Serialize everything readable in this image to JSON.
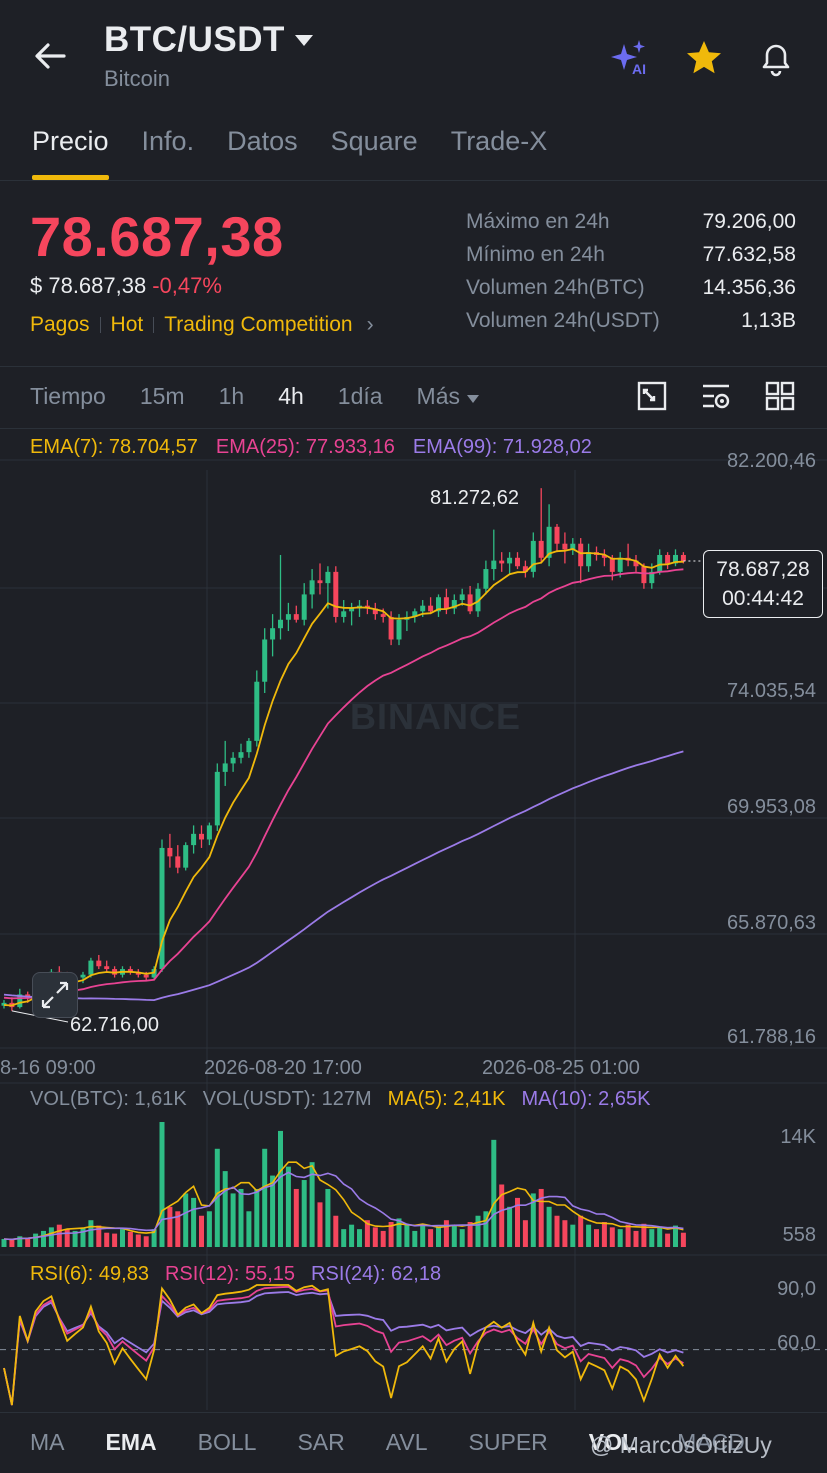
{
  "header": {
    "pair": "BTC/USDT",
    "name": "Bitcoin"
  },
  "tabs": [
    "Precio",
    "Info.",
    "Datos",
    "Square",
    "Trade-X"
  ],
  "price": {
    "last": "78.687,38",
    "usd": "$ 78.687,38",
    "change": "-0,47%"
  },
  "links": [
    "Pagos",
    "Hot",
    "Trading Competition"
  ],
  "stats": [
    {
      "label": "Máximo en 24h",
      "value": "79.206,00"
    },
    {
      "label": "Mínimo en 24h",
      "value": "77.632,58"
    },
    {
      "label": "Volumen 24h(BTC)",
      "value": "14.356,36"
    },
    {
      "label": "Volumen 24h(USDT)",
      "value": "1,13B"
    }
  ],
  "timeframes": [
    "Tiempo",
    "15m",
    "1h",
    "4h",
    "1día",
    "Más"
  ],
  "active_timeframe": "4h",
  "ema_legend": {
    "ema7": "EMA(7): 78.704,57",
    "ema25": "EMA(25): 77.933,16",
    "ema99": "EMA(99): 71.928,02"
  },
  "price_axis": [
    "82.200,46",
    "74.035,54",
    "69.953,08",
    "65.870,63",
    "61.788,16"
  ],
  "time_axis": [
    "8-16 09:00",
    "2026-08-20 17:00",
    "2026-08-25 01:00"
  ],
  "annotations": {
    "high": "81.272,62",
    "low": "62.716,00",
    "current_price": "78.687,28",
    "countdown": "00:44:42"
  },
  "watermark": "BINANCE",
  "vol_legend": {
    "btc": "VOL(BTC): 1,61K",
    "usdt": "VOL(USDT): 127M",
    "ma5": "MA(5): 2,41K",
    "ma10": "MA(10): 2,65K"
  },
  "vol_axis": [
    "14K",
    "558"
  ],
  "rsi_legend": {
    "rsi6": "RSI(6): 49,83",
    "rsi12": "RSI(12): 55,15",
    "rsi24": "RSI(24): 62,18"
  },
  "rsi_axis": [
    "90,0",
    "60,0"
  ],
  "indicators": [
    "MA",
    "EMA",
    "BOLL",
    "SAR",
    "AVL",
    "SUPER",
    "VOL",
    "MACD"
  ],
  "credit": "@ MarcosOrtizUy",
  "colors": {
    "up": "#2ebd85",
    "down": "#f6465d",
    "ema7": "#f0b90b",
    "ema25": "#e84393",
    "ema99": "#9b7be8",
    "accent": "#f0b90b"
  },
  "chart_data": {
    "type": "candlestick",
    "interval": "4h",
    "ylim": [
      61788.16,
      82200.46
    ],
    "ohlc_up_down": [
      [
        62900,
        63100,
        62800,
        63000,
        1
      ],
      [
        63000,
        63200,
        62716,
        62850,
        0
      ],
      [
        62850,
        63500,
        62800,
        63300,
        1
      ],
      [
        63300,
        63400,
        63000,
        63200,
        0
      ],
      [
        63200,
        63800,
        63100,
        63600,
        1
      ],
      [
        63600,
        64000,
        63400,
        63900,
        1
      ],
      [
        63900,
        64200,
        63700,
        64100,
        1
      ],
      [
        64100,
        64300,
        63800,
        63950,
        0
      ],
      [
        63950,
        64100,
        63600,
        63800,
        0
      ],
      [
        63800,
        64000,
        63600,
        63900,
        1
      ],
      [
        63900,
        64100,
        63700,
        64000,
        1
      ],
      [
        64000,
        64600,
        63900,
        64500,
        1
      ],
      [
        64500,
        64700,
        64200,
        64300,
        0
      ],
      [
        64300,
        64500,
        64100,
        64200,
        0
      ],
      [
        64200,
        64300,
        63900,
        64000,
        0
      ],
      [
        64000,
        64300,
        63900,
        64200,
        1
      ],
      [
        64200,
        64300,
        64000,
        64100,
        0
      ],
      [
        64100,
        64200,
        63900,
        64000,
        0
      ],
      [
        64000,
        64100,
        63800,
        63900,
        0
      ],
      [
        63900,
        64300,
        63800,
        64200,
        1
      ],
      [
        64200,
        68800,
        64100,
        68500,
        1
      ],
      [
        68500,
        69000,
        67800,
        68200,
        0
      ],
      [
        68200,
        68600,
        67600,
        67800,
        0
      ],
      [
        67800,
        68700,
        67700,
        68600,
        1
      ],
      [
        68600,
        69300,
        68300,
        69000,
        1
      ],
      [
        69000,
        69300,
        68500,
        68800,
        0
      ],
      [
        68800,
        69400,
        68600,
        69300,
        1
      ],
      [
        69300,
        71500,
        69100,
        71200,
        1
      ],
      [
        71200,
        72300,
        70700,
        71500,
        1
      ],
      [
        71500,
        71900,
        71200,
        71700,
        1
      ],
      [
        71700,
        72200,
        71500,
        71900,
        1
      ],
      [
        71900,
        72400,
        71700,
        72300,
        1
      ],
      [
        72300,
        74800,
        72100,
        74400,
        1
      ],
      [
        74400,
        76300,
        74000,
        75900,
        1
      ],
      [
        75900,
        76800,
        75300,
        76300,
        1
      ],
      [
        76300,
        78900,
        75900,
        76600,
        1
      ],
      [
        76600,
        77200,
        76200,
        76800,
        1
      ],
      [
        76800,
        77100,
        76500,
        76600,
        0
      ],
      [
        76600,
        77900,
        76400,
        77500,
        1
      ],
      [
        77500,
        78400,
        77000,
        78000,
        1
      ],
      [
        78000,
        78600,
        77500,
        77900,
        0
      ],
      [
        77900,
        78500,
        77000,
        78300,
        1
      ],
      [
        78300,
        78500,
        76500,
        76700,
        0
      ],
      [
        76700,
        77300,
        76500,
        76900,
        1
      ],
      [
        76900,
        77200,
        76400,
        77000,
        1
      ],
      [
        77000,
        77300,
        76700,
        77100,
        1
      ],
      [
        77100,
        77300,
        76800,
        77000,
        0
      ],
      [
        77000,
        77200,
        76600,
        76800,
        0
      ],
      [
        76800,
        77000,
        76500,
        76700,
        0
      ],
      [
        76700,
        76900,
        75700,
        75900,
        0
      ],
      [
        75900,
        76800,
        75700,
        76600,
        1
      ],
      [
        76600,
        76900,
        76200,
        76700,
        1
      ],
      [
        76700,
        77000,
        76500,
        76900,
        1
      ],
      [
        76900,
        77300,
        76700,
        77100,
        1
      ],
      [
        77100,
        77400,
        76800,
        76900,
        0
      ],
      [
        76900,
        77500,
        76700,
        77400,
        1
      ],
      [
        77400,
        77700,
        76800,
        77000,
        0
      ],
      [
        77000,
        77500,
        76800,
        77300,
        1
      ],
      [
        77300,
        77700,
        77100,
        77500,
        1
      ],
      [
        77500,
        77800,
        76800,
        76900,
        0
      ],
      [
        76900,
        77900,
        76700,
        77700,
        1
      ],
      [
        77700,
        78700,
        77500,
        78400,
        1
      ],
      [
        78400,
        79800,
        78000,
        78700,
        1
      ],
      [
        78700,
        79000,
        78300,
        78600,
        0
      ],
      [
        78600,
        79000,
        78200,
        78800,
        1
      ],
      [
        78800,
        79000,
        78400,
        78500,
        0
      ],
      [
        78500,
        78700,
        78100,
        78300,
        0
      ],
      [
        78300,
        79700,
        78100,
        79400,
        1
      ],
      [
        79400,
        81272,
        78600,
        78800,
        0
      ],
      [
        78800,
        80700,
        78500,
        79900,
        1
      ],
      [
        79900,
        80000,
        79000,
        79300,
        0
      ],
      [
        79300,
        79700,
        78600,
        79100,
        0
      ],
      [
        79100,
        79500,
        78900,
        79300,
        1
      ],
      [
        79300,
        79500,
        77900,
        78500,
        0
      ],
      [
        78500,
        79300,
        78300,
        79000,
        1
      ],
      [
        79000,
        79200,
        78700,
        78900,
        0
      ],
      [
        78900,
        79100,
        78500,
        78800,
        0
      ],
      [
        78800,
        78900,
        78000,
        78300,
        0
      ],
      [
        78300,
        79000,
        78100,
        78800,
        1
      ],
      [
        78800,
        79300,
        78500,
        78700,
        0
      ],
      [
        78700,
        78900,
        78300,
        78500,
        0
      ],
      [
        78500,
        78600,
        77700,
        77900,
        0
      ],
      [
        77900,
        78600,
        77700,
        78300,
        1
      ],
      [
        78300,
        79100,
        78200,
        78900,
        1
      ],
      [
        78900,
        79000,
        78400,
        78600,
        0
      ],
      [
        78600,
        79100,
        78500,
        78900,
        1
      ],
      [
        78900,
        79000,
        78600,
        78687,
        0
      ]
    ],
    "ema7_end": 78704.57,
    "ema25_end": 77933.16,
    "ema99_end": 71928.02,
    "high_label": 81272.62,
    "low_label": 62716.0,
    "volume_k": [
      0.9,
      0.8,
      1.2,
      1.0,
      1.5,
      1.8,
      2.2,
      2.5,
      2.0,
      1.8,
      2.1,
      3.0,
      2.4,
      1.6,
      1.5,
      2.0,
      1.7,
      1.4,
      1.2,
      2.0,
      14.0,
      4.5,
      4.0,
      6.0,
      5.5,
      3.5,
      4.0,
      11.0,
      8.5,
      6.0,
      6.5,
      4.0,
      6.5,
      11.0,
      8.0,
      13.0,
      9.0,
      6.5,
      7.5,
      9.5,
      5.0,
      6.5,
      3.5,
      2.0,
      2.5,
      2.0,
      3.0,
      2.2,
      1.8,
      2.8,
      3.2,
      2.5,
      1.8,
      2.5,
      2.0,
      2.2,
      3.0,
      2.5,
      2.0,
      2.8,
      3.5,
      4.0,
      12.0,
      7.0,
      4.5,
      5.5,
      3.0,
      6.0,
      6.5,
      4.5,
      3.5,
      3.0,
      2.5,
      3.5,
      2.5,
      2.0,
      2.8,
      2.2,
      2.0,
      2.5,
      1.8,
      2.6,
      2.0,
      2.2,
      1.5,
      2.4,
      1.6
    ],
    "vol_ylim": [
      0,
      14000
    ],
    "rsi_ylim": [
      30,
      95
    ]
  }
}
